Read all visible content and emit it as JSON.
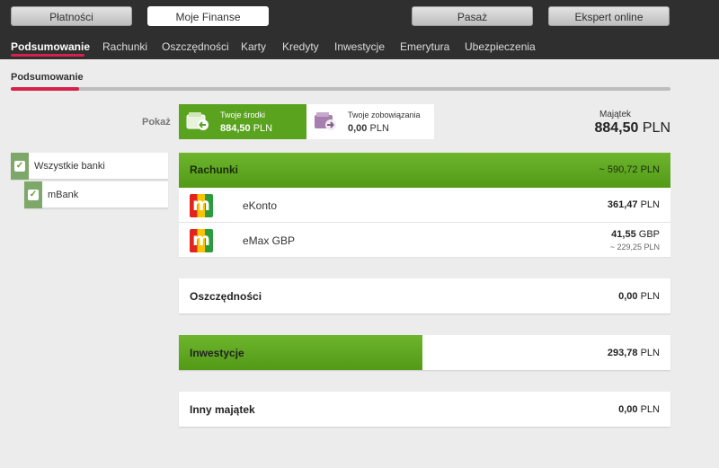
{
  "top_buttons": {
    "payments": "Płatności",
    "my_finance": "Moje Finanse",
    "passage": "Pasaż",
    "expert": "Ekspert online"
  },
  "nav": {
    "items": [
      "Podsumowanie",
      "Rachunki",
      "Oszczędności",
      "Karty",
      "Kredyty",
      "Inwestycje",
      "Emerytura",
      "Ubezpieczenia"
    ],
    "active": "Podsumowanie"
  },
  "subtab": {
    "label": "Podsumowanie"
  },
  "show": {
    "label": "Pokaż",
    "funds": {
      "title": "Twoje środki",
      "value": "884,50",
      "currency": "PLN"
    },
    "liabilities": {
      "title": "Twoje zobowiązania",
      "value": "0,00",
      "currency": "PLN"
    }
  },
  "assets": {
    "label": "Majątek",
    "value": "884,50",
    "currency": "PLN"
  },
  "filters": {
    "all_banks": "Wszystkie banki",
    "mbank": "mBank"
  },
  "accounts": {
    "header": {
      "title": "Rachunki",
      "value": "~ 590,72",
      "currency": "PLN"
    },
    "rows": [
      {
        "logo": "m",
        "name": "eKonto",
        "value": "361,47",
        "currency": "PLN"
      },
      {
        "logo": "m",
        "name": "eMax GBP",
        "value": "41,55",
        "currency": "GBP",
        "converted": "~ 229,25 PLN"
      }
    ]
  },
  "savings": {
    "title": "Oszczędności",
    "value": "0,00",
    "currency": "PLN"
  },
  "investments": {
    "title": "Inwestycje",
    "value": "293,78",
    "currency": "PLN",
    "bar_fraction": 0.495
  },
  "other_assets": {
    "title": "Inny majątek",
    "value": "0,00",
    "currency": "PLN"
  },
  "colors": {
    "accent": "#d6214a",
    "green": "#5aa31f",
    "dark": "#2f2f2f"
  }
}
